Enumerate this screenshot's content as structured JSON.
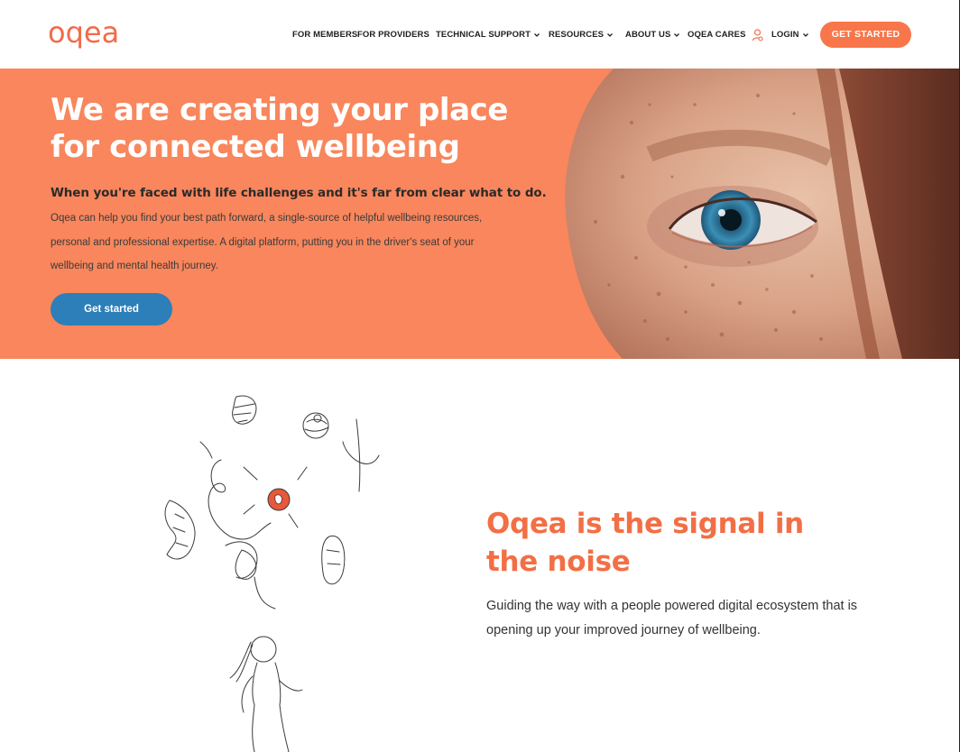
{
  "header": {
    "logo": "oqea",
    "nav": [
      {
        "label": "FOR MEMBERS",
        "dropdown": false
      },
      {
        "label": "FOR PROVIDERS",
        "dropdown": false
      },
      {
        "label": "TECHNICAL SUPPORT",
        "dropdown": true
      },
      {
        "label": "RESOURCES",
        "dropdown": true
      },
      {
        "label": "ABOUT US",
        "dropdown": true
      },
      {
        "label": "OQEA CARES",
        "dropdown": false,
        "icon": "person-icon"
      },
      {
        "label": "LOGIN",
        "dropdown": true
      }
    ],
    "cta": "GET STARTED"
  },
  "hero": {
    "title": "We are creating your place for connected wellbeing",
    "subtitle": "When you're faced with life challenges and it's far from clear what to do.",
    "body": "Oqea can help you find your best path forward, a single-source of helpful wellbeing resources, personal and professional expertise. A digital platform, putting you in the driver's seat of your wellbeing and mental health journey.",
    "button": "Get started",
    "image": "freckled-face-eye-photo"
  },
  "signal": {
    "title": "Oqea is the signal in the noise",
    "body": "Guiding the way with a people powered digital ecosystem that is opening up your improved journey of wellbeing.",
    "illustration": "person-walking-with-floating-doodles"
  },
  "colors": {
    "brand_orange": "#f26b4a",
    "hero_bg": "#f9865c",
    "button_blue": "#2c7fb8"
  }
}
